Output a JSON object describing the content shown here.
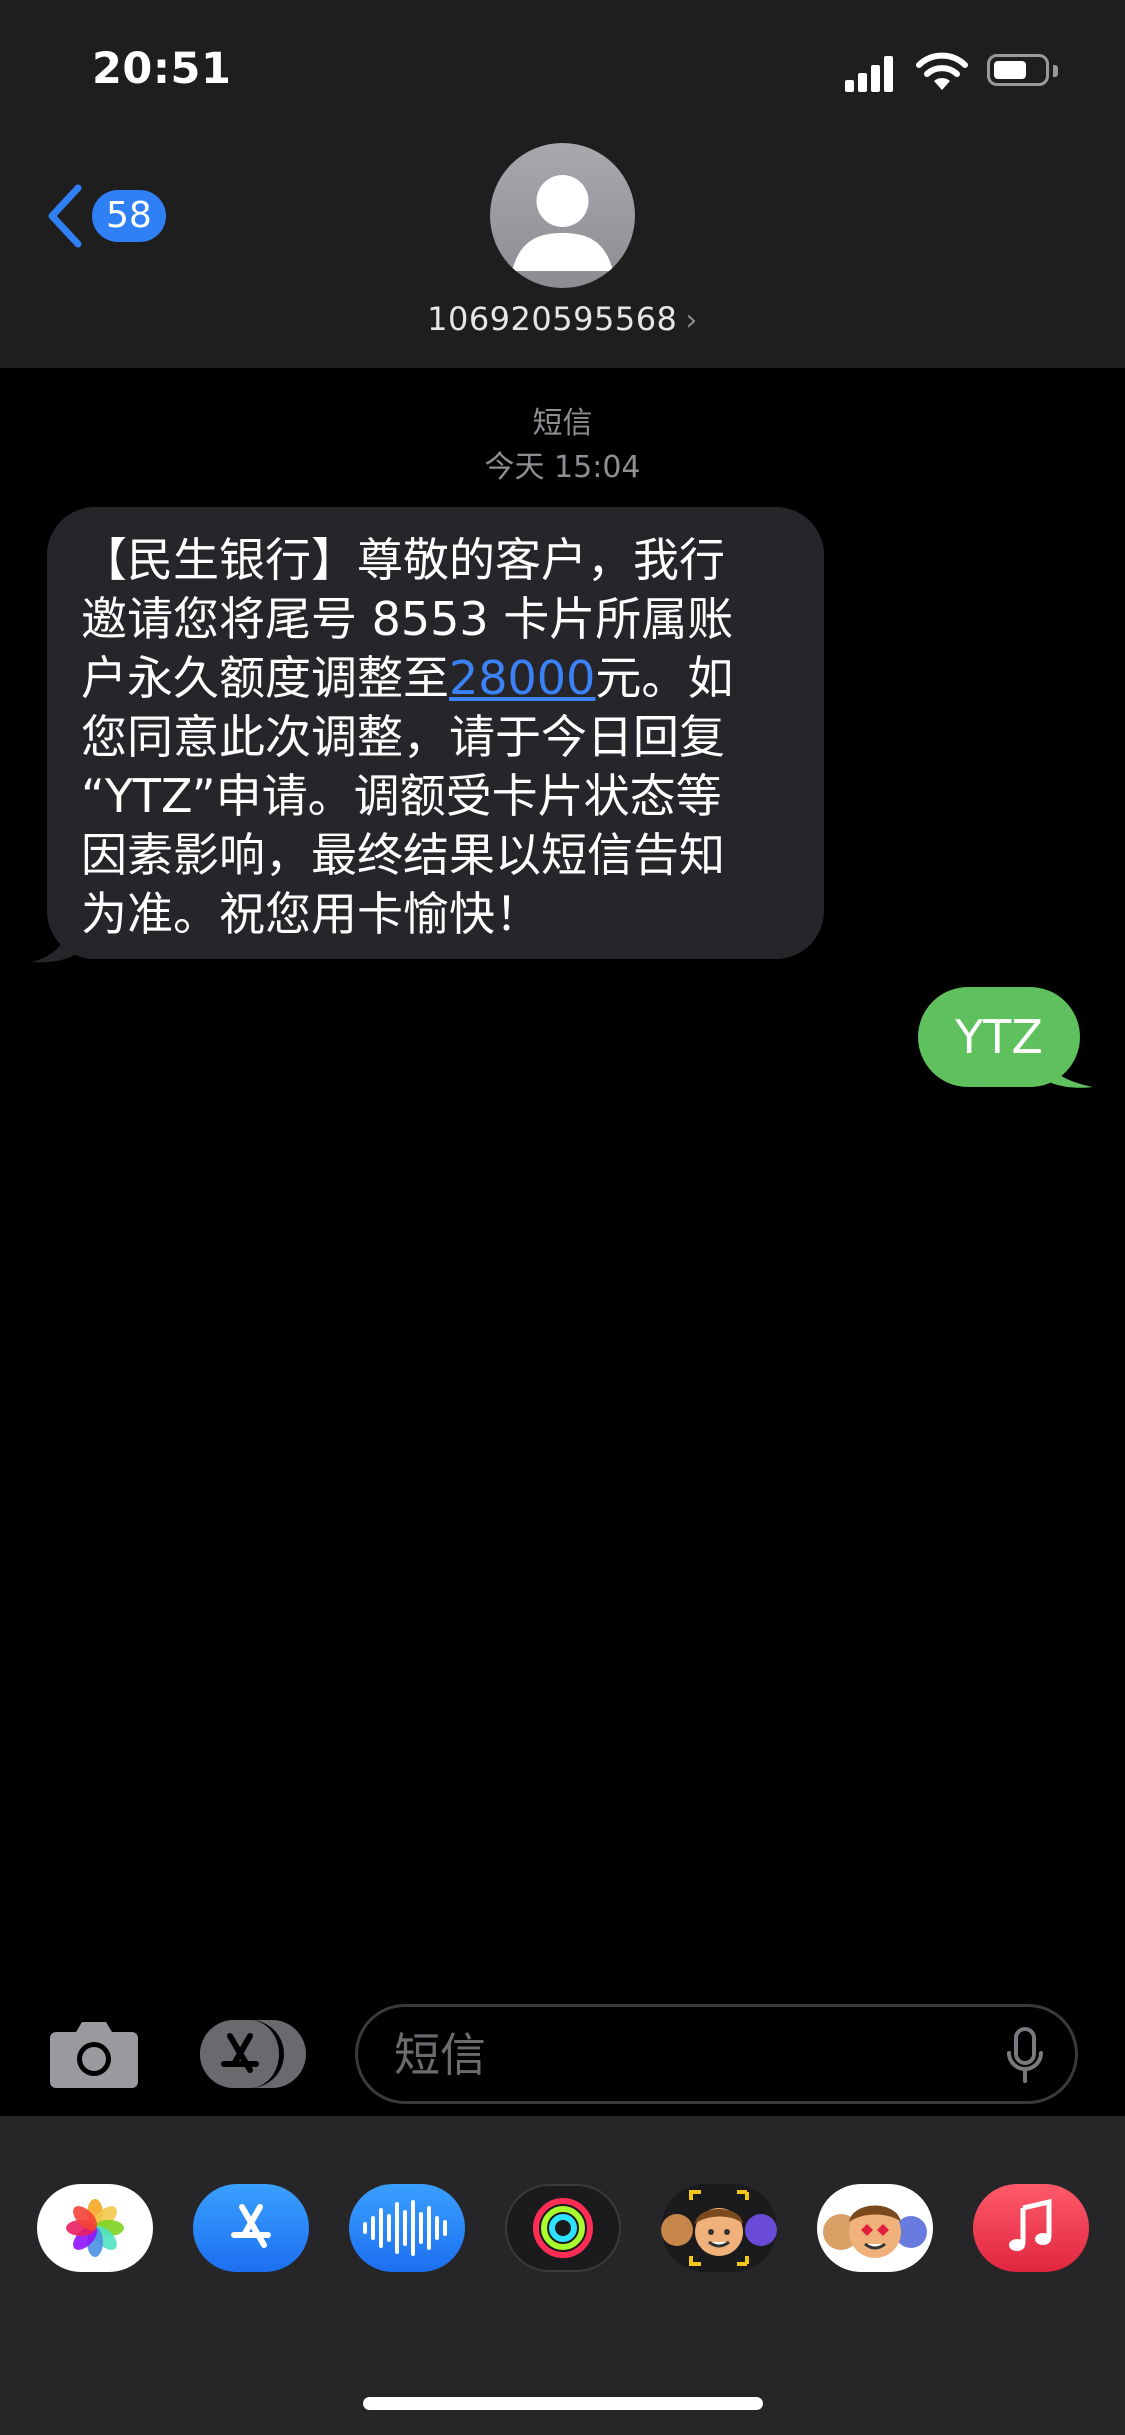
{
  "status_bar": {
    "time": "20:51"
  },
  "nav": {
    "back_count": "58",
    "contact_number": "106920595568",
    "contact_chevron": "›"
  },
  "conversation": {
    "service_label": "短信",
    "timestamp": "今天 15:04"
  },
  "messages": [
    {
      "direction": "incoming",
      "lines": [
        "【民生银行】尊敬的客户，我行",
        "邀请您将尾号 8553 卡片所属账",
        "户永久额度调整至",
        "28000",
        "元。如",
        "您同意此次调整，请于今日回复",
        "“YTZ”申请。调额受卡片状态等",
        "因素影响，最终结果以短信告知",
        "为准。祝您用卡愉快！"
      ]
    },
    {
      "direction": "outgoing",
      "text": "YTZ"
    }
  ],
  "input": {
    "placeholder": "短信"
  },
  "app_tray": [
    {
      "name": "photos-app-icon"
    },
    {
      "name": "app-store-icon"
    },
    {
      "name": "audio-message-icon"
    },
    {
      "name": "activity-icon"
    },
    {
      "name": "memoji-camera-icon"
    },
    {
      "name": "memoji-stickers-icon"
    },
    {
      "name": "music-app-icon"
    }
  ],
  "colors": {
    "incoming_bubble": "#26262a",
    "outgoing_bubble": "#5ec15d",
    "accent": "#2f7ff5",
    "link": "#3b82f6"
  }
}
